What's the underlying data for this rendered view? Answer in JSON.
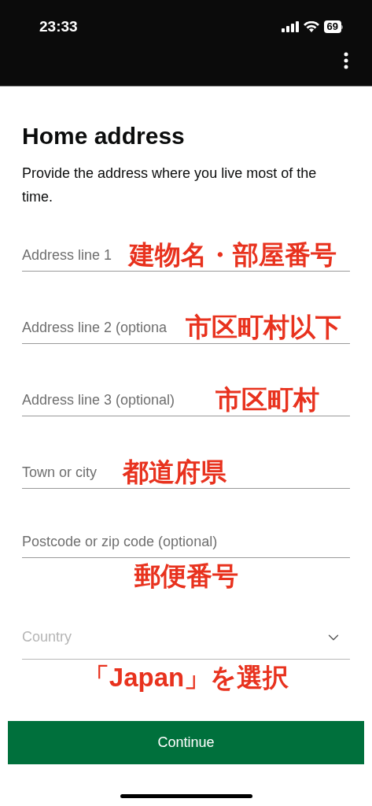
{
  "status_bar": {
    "time": "23:33",
    "battery": "69"
  },
  "page": {
    "title": "Home address",
    "hint": "Provide the address where you live most of the time."
  },
  "fields": [
    {
      "kind": "text",
      "placeholder": "Address line 1",
      "annotation": {
        "text": "建物名・部屋番号",
        "kind": "inline"
      }
    },
    {
      "kind": "text",
      "placeholder": "Address line 2 (optiona",
      "annotation": {
        "text": "市区町村以下",
        "kind": "inline"
      }
    },
    {
      "kind": "text",
      "placeholder": "Address line 3 (optional)",
      "annotation": {
        "text": "市区町村",
        "kind": "inline"
      }
    },
    {
      "kind": "text",
      "placeholder": "Town or city",
      "annotation": {
        "text": "都道府県",
        "kind": "inline"
      }
    },
    {
      "kind": "text",
      "placeholder": "Postcode or zip code (optional)",
      "annotation": {
        "text": "郵便番号",
        "kind": "below"
      }
    },
    {
      "kind": "select",
      "placeholder": "Country",
      "annotation": {
        "text": "「Japan」を選択",
        "kind": "below"
      }
    }
  ],
  "continue_button": "Continue"
}
